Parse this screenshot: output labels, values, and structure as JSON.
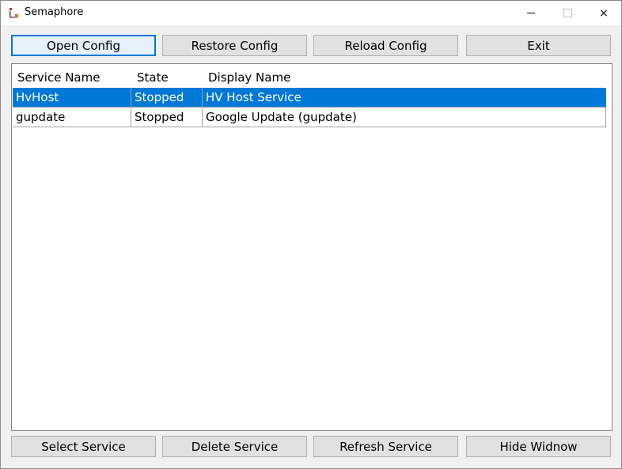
{
  "window": {
    "title": "Semaphore",
    "controls": {
      "minimize": "minimize",
      "maximize": "maximize",
      "close": "×"
    }
  },
  "top_buttons": [
    {
      "label": "Open Config"
    },
    {
      "label": "Restore Config"
    },
    {
      "label": "Reload Config"
    },
    {
      "label": "Exit"
    }
  ],
  "list": {
    "columns": [
      "Service Name",
      "State",
      "Display Name"
    ],
    "rows": [
      {
        "service_name": "HvHost",
        "state": "Stopped",
        "display_name": "HV Host Service",
        "selected": true
      },
      {
        "service_name": "gupdate",
        "state": "Stopped",
        "display_name": "Google Update (gupdate)",
        "selected": false
      }
    ]
  },
  "bottom_buttons": [
    {
      "label": "Select Service"
    },
    {
      "label": "Delete Service"
    },
    {
      "label": "Refresh Service"
    },
    {
      "label": "Hide Widnow"
    }
  ],
  "colors": {
    "selection": "#0078d7",
    "focus_border": "#0078d7"
  }
}
